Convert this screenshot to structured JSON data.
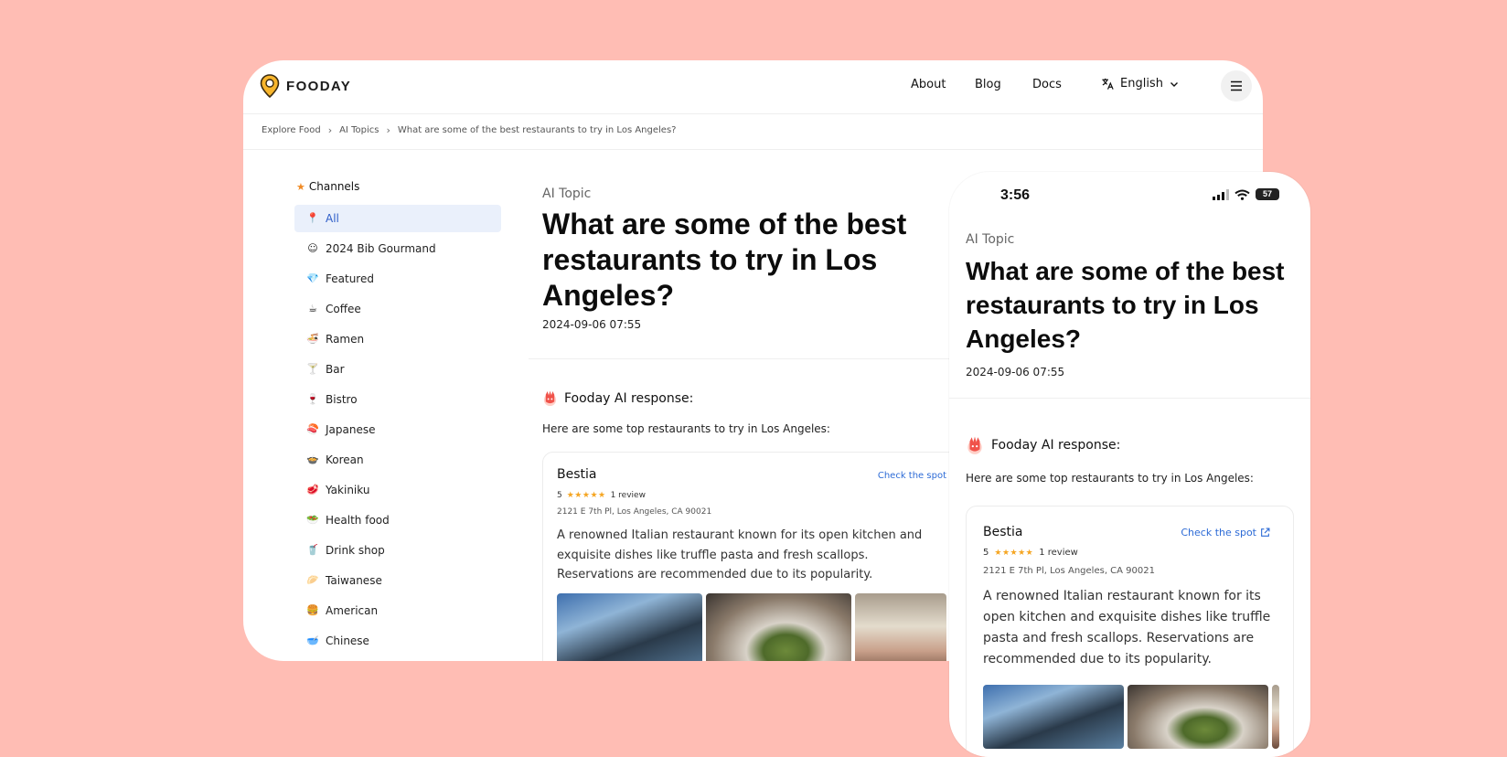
{
  "brand": {
    "name": "FOODAY"
  },
  "nav": {
    "links": [
      "About",
      "Blog",
      "Docs"
    ],
    "language": "English"
  },
  "breadcrumb": [
    "Explore Food",
    "AI Topics",
    "What are some of the best restaurants to try in Los Angeles?"
  ],
  "sidebar": {
    "heading": "Channels",
    "items": [
      {
        "label": "All",
        "icon": "pin-icon",
        "glyph": "📍",
        "active": true
      },
      {
        "label": "2024 Bib Gourmand",
        "icon": "bib-gourmand-icon",
        "glyph": "☺"
      },
      {
        "label": "Featured",
        "icon": "diamond-icon",
        "glyph": "💎"
      },
      {
        "label": "Coffee",
        "icon": "coffee-bean-icon",
        "glyph": "☕"
      },
      {
        "label": "Ramen",
        "icon": "ramen-icon",
        "glyph": "🍜"
      },
      {
        "label": "Bar",
        "icon": "cocktail-icon",
        "glyph": "🍸"
      },
      {
        "label": "Bistro",
        "icon": "wine-glass-icon",
        "glyph": "🍷"
      },
      {
        "label": "Japanese",
        "icon": "sushi-icon",
        "glyph": "🍣"
      },
      {
        "label": "Korean",
        "icon": "korean-food-icon",
        "glyph": "🍲"
      },
      {
        "label": "Yakiniku",
        "icon": "meat-icon",
        "glyph": "🥩"
      },
      {
        "label": "Health food",
        "icon": "salad-icon",
        "glyph": "🥗"
      },
      {
        "label": "Drink shop",
        "icon": "bubble-tea-icon",
        "glyph": "🥤"
      },
      {
        "label": "Taiwanese",
        "icon": "taiwanese-food-icon",
        "glyph": "🥟"
      },
      {
        "label": "American",
        "icon": "burger-icon",
        "glyph": "🍔"
      },
      {
        "label": "Chinese",
        "icon": "bowl-icon",
        "glyph": "🥣"
      }
    ]
  },
  "article": {
    "kicker": "AI Topic",
    "title": "What are some of the best restaurants to try in Los Angeles?",
    "date": "2024-09-06 07:55",
    "ai_heading": "Fooday AI response:",
    "intro": "Here are some top restaurants to try in Los Angeles:"
  },
  "restaurant": {
    "name": "Bestia",
    "check_label": "Check the spot",
    "rating": "5",
    "stars": "★★★★★",
    "reviews": "1 review",
    "address": "2121 E 7th Pl, Los Angeles, CA 90021",
    "description": "A renowned Italian restaurant known for its open kitchen and exquisite dishes like truffle pasta and fresh scallops. Reservations are recommended due to its popularity."
  },
  "phone_status": {
    "time": "3:56",
    "battery": "57"
  },
  "colors": {
    "background": "#ffbdb4",
    "accent_blue": "#2d5dc8",
    "star": "#f5a623",
    "channel_star": "#f08a24"
  }
}
